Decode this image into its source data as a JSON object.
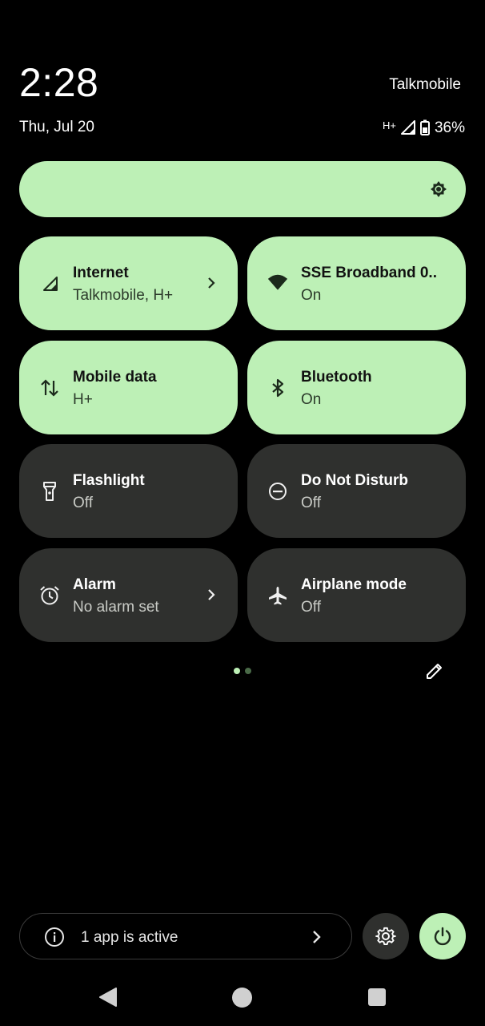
{
  "header": {
    "time": "2:28",
    "carrier": "Talkmobile",
    "date": "Thu, Jul 20",
    "network_type": "H+",
    "battery": "36%"
  },
  "brightness": {
    "icon": "brightness-icon",
    "level": 1.0
  },
  "tiles": [
    {
      "label": "Internet",
      "sub": "Talkmobile, H+",
      "state": "on",
      "icon": "cellular-signal-icon",
      "chevron": true
    },
    {
      "label": "SSE Broadband 0..",
      "sub": "On",
      "state": "on",
      "icon": "wifi-icon",
      "chevron": false
    },
    {
      "label": "Mobile data",
      "sub": "H+",
      "state": "on",
      "icon": "mobile-data-icon",
      "chevron": false
    },
    {
      "label": "Bluetooth",
      "sub": "On",
      "state": "on",
      "icon": "bluetooth-icon",
      "chevron": false
    },
    {
      "label": "Flashlight",
      "sub": "Off",
      "state": "off",
      "icon": "flashlight-icon",
      "chevron": false
    },
    {
      "label": "Do Not Disturb",
      "sub": "Off",
      "state": "off",
      "icon": "do-not-disturb-icon",
      "chevron": false
    },
    {
      "label": "Alarm",
      "sub": "No alarm set",
      "state": "off",
      "icon": "alarm-icon",
      "chevron": true
    },
    {
      "label": "Airplane mode",
      "sub": "Off",
      "state": "off",
      "icon": "airplane-icon",
      "chevron": false
    }
  ],
  "pager": {
    "pages": 2,
    "current": 1
  },
  "footer": {
    "active_apps": "1 app is active"
  },
  "colors": {
    "background": "#000000",
    "tile_on": "#bdf0b6",
    "tile_off": "#2f302e",
    "accent": "#bdf0b6"
  }
}
